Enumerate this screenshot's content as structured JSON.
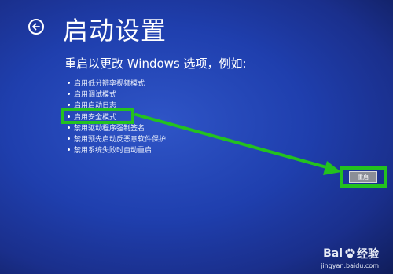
{
  "header": {
    "title": "启动设置"
  },
  "subtitle": "重启以更改 Windows 选项，例如:",
  "options": [
    "启用低分辨率视频模式",
    "启用调试模式",
    "启用启动日志",
    "启用安全模式",
    "禁用驱动程序强制签名",
    "禁用预先启动反恶意软件保护",
    "禁用系统失败时自动重启"
  ],
  "restart_label": "重启",
  "annotation": {
    "highlight_color": "#23c21f"
  },
  "watermark": {
    "brand_left": "Bai",
    "brand_right": "经验",
    "url": "jingyan.baidu.com"
  },
  "colors": {
    "background": "#1f3fae",
    "text": "#ffffff",
    "button": "#8b8e97"
  }
}
